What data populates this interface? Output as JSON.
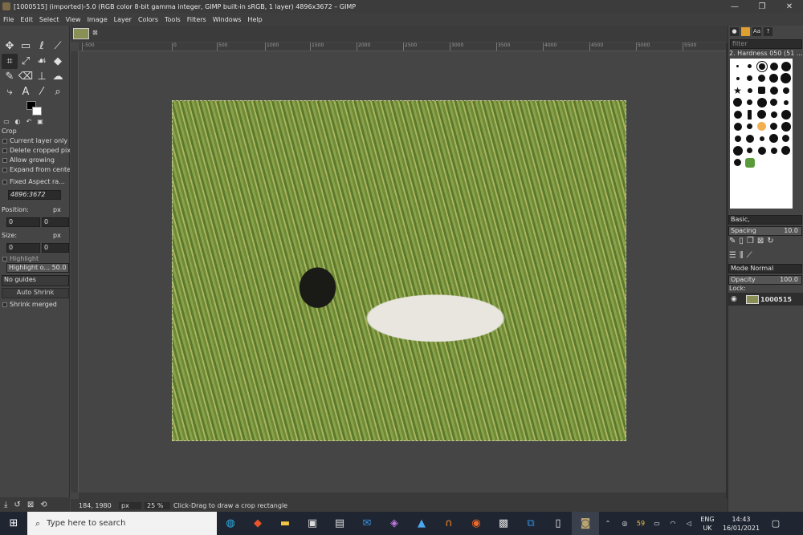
{
  "window": {
    "title": "[1000515] (imported)-5.0 (RGB color 8-bit gamma integer, GIMP built-in sRGB, 1 layer) 4896x3672 – GIMP",
    "controls": [
      "—",
      "❐",
      "✕"
    ]
  },
  "menu": [
    "File",
    "Edit",
    "Select",
    "View",
    "Image",
    "Layer",
    "Colors",
    "Tools",
    "Filters",
    "Windows",
    "Help"
  ],
  "tool_options": {
    "tool_name": "Crop",
    "current_layer_only": "Current layer only",
    "delete_cropped": "Delete cropped pix",
    "allow_growing": "Allow growing",
    "expand_from_center": "Expand from center",
    "fixed_aspect": "Fixed Aspect ra...",
    "aspect_value": "4896:3672",
    "position_label": "Position:",
    "position_unit": "px",
    "position_x": "0",
    "position_y": "0",
    "size_label": "Size:",
    "size_unit": "px",
    "size_w": "0",
    "size_h": "0",
    "highlight": "Highlight",
    "highlight_opacity_label": "Highlight o...",
    "highlight_opacity_value": "50.0",
    "guides": "No guides",
    "auto_shrink": "Auto Shrink",
    "shrink_merged": "Shrink merged"
  },
  "ruler_ticks": [
    "-500",
    "0",
    "500",
    "1000",
    "1500",
    "2000",
    "2500",
    "3000",
    "3500",
    "4000",
    "4500",
    "5000",
    "5500"
  ],
  "status": {
    "coords": "184, 1980",
    "unit": "px",
    "zoom": "25 %",
    "message": "Click-Drag to draw a crop rectangle"
  },
  "dock": {
    "filter_placeholder": "filter",
    "brush_name": "2. Hardness 050 (51 ...",
    "brush_preset": "Basic,",
    "spacing_label": "Spacing",
    "spacing_value": "10.0",
    "mode_label": "Mode Normal",
    "opacity_label": "Opacity",
    "opacity_value": "100.0",
    "lock_label": "Lock:",
    "layer_name": "1000515"
  },
  "taskbar": {
    "search_placeholder": "Type here to search",
    "weather_temp": "59",
    "lang": "ENG",
    "region": "UK",
    "time": "14:43",
    "date": "16/01/2021"
  }
}
